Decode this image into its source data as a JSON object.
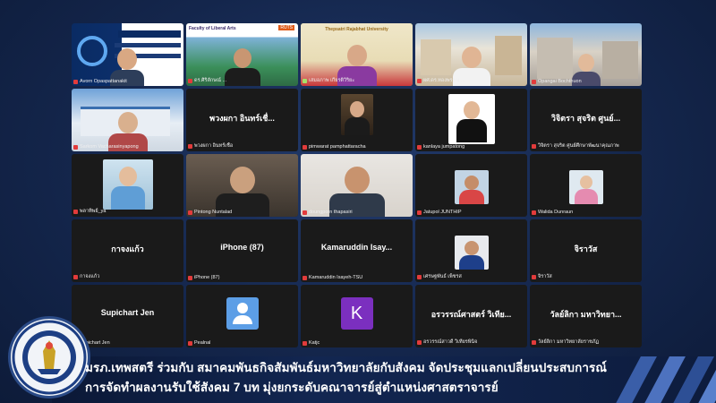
{
  "participants": [
    {
      "name": "Avorn Opaspattanakit"
    },
    {
      "name": "ดร.ศิริลักษณ์ ...",
      "title_text": "Faculty of Liberal Arts",
      "badge": "RUTS"
    },
    {
      "name": "เสมอภาพ เกียรติวิริยะ",
      "title_text": "Thepsatri Rajabhat University"
    },
    {
      "name": "ผศ.ดร.ทองพรรณ ..."
    },
    {
      "name": "Opangai Bochthuon"
    },
    {
      "name": "Sarkom Vacharasinyapong"
    },
    {
      "name": "พวงผกา อินทร์เชื้อ",
      "center_text": "พวงผกา อินทร์เชื่..."
    },
    {
      "name": "pimwarat pamphattaracha"
    },
    {
      "name": "kanlaya jumpatong"
    },
    {
      "name": "วิจิตรา สุจริต ศูนย์ศึกษาพัฒนาคุณภาพ",
      "center_text": "วิจิตรา สุจริต ศูนย์..."
    },
    {
      "name": "พลาทิพย์_ya"
    },
    {
      "name": "Pintong Nuntalad"
    },
    {
      "name": "doungporn thapasiri"
    },
    {
      "name": "Jatupol JUNTHIP"
    },
    {
      "name": "Walida Dunraun"
    },
    {
      "name": "กาจงแก้ว",
      "center_text": "กาจงแก้ว"
    },
    {
      "name": "iPhone (87)",
      "center_text": "iPhone (87)"
    },
    {
      "name": "Kamaruddin Isayeh-TSU",
      "center_text": "Kamaruddin Isay..."
    },
    {
      "name": "เศรษฐพันธ์ เพ็ชรส"
    },
    {
      "name": "จิราวัส",
      "center_text": "จิราวัส"
    },
    {
      "name": "Supichart Jen",
      "center_text": "Supichart Jen"
    },
    {
      "name": "Pealnal"
    },
    {
      "name": "Katjc",
      "initial": "K"
    },
    {
      "name": "อรวรรณ์สาวดี วิเทียรพินิจ",
      "center_text": "อรวรรณ์ศาสตร์ วิเทีย..."
    },
    {
      "name": "วัลย์ลิกา มหาวิทยาลัยราชภัฏ",
      "center_text": "วัลย์ลิกา มหาวิทยา..."
    }
  ],
  "caption": {
    "line1": "มรภ.เทพสตรี ร่วมกับ สมาคมพันธกิจสัมพันธ์มหาวิทยาลัยกับสังคม จัดประชุมแลกเปลี่ยนประสบการณ์",
    "line2": "การจัดทำผลงานรับใช้สังคม 7 บท มุ่งยกระดับคณาจารย์สู่ตำแหน่งศาสตราจารย์"
  },
  "colors": {
    "background": "#14264c",
    "active_speaker": "#a8e06a",
    "mute_icon": "#e23b3b",
    "zoom_avatar": "#5c9ee6",
    "initial_avatar": "#7b2fbf"
  },
  "icons": [
    "muted-mic-icon",
    "default-user-icon",
    "university-seal-icon"
  ]
}
